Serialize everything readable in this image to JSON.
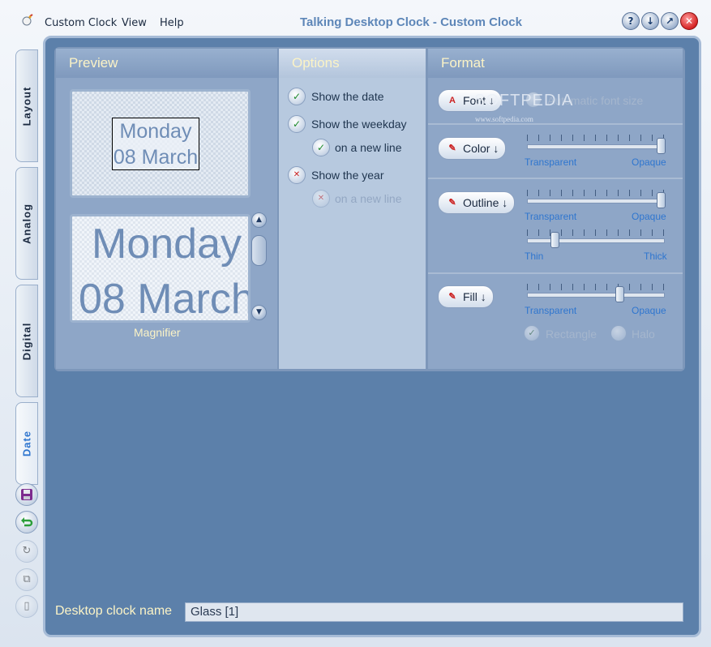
{
  "window": {
    "title": "Talking Desktop Clock - Custom Clock",
    "menu": [
      "Custom Clock",
      "View",
      "Help"
    ],
    "title_buttons": [
      "?",
      "↓",
      "↗",
      "✕"
    ]
  },
  "side_tabs": [
    "Layout",
    "Analog",
    "Digital",
    "Date"
  ],
  "side_buttons": [
    "save-icon",
    "undo-icon",
    "refresh-icon",
    "copy-icon",
    "delete-icon"
  ],
  "preview": {
    "header": "Preview",
    "line1": "Monday",
    "line2": "08 March",
    "magnifier_label": "Magnifier"
  },
  "options": {
    "header": "Options",
    "items": [
      {
        "label": "Show the date",
        "state": "on"
      },
      {
        "label": "Show the weekday",
        "state": "on"
      },
      {
        "label": "on a new line",
        "state": "on"
      },
      {
        "label": "Show the year",
        "state": "off"
      },
      {
        "label": "on a new line",
        "state": "disabled"
      }
    ]
  },
  "format": {
    "header": "Format",
    "font_button": "Font ↓",
    "automatic_font_size": "Automatic font size",
    "color_button": "Color ↓",
    "outline_button": "Outline ↓",
    "fill_button": "Fill ↓",
    "transparent": "Transparent",
    "opaque": "Opaque",
    "thin": "Thin",
    "thick": "Thick",
    "rectangle": "Rectangle",
    "halo": "Halo",
    "color_opacity": 1.0,
    "outline_opacity": 1.0,
    "outline_thickness": 0.18,
    "fill_opacity": 0.68
  },
  "watermark": {
    "text": "SOFTPEDIA",
    "sub": "www.softpedia.com"
  },
  "footer": {
    "name_label": "Desktop clock name",
    "name_value": "Glass [1]"
  },
  "colors": {
    "frame": "#5c80aa",
    "header_text": "#fbf3c6",
    "accent": "#2f76cf"
  }
}
